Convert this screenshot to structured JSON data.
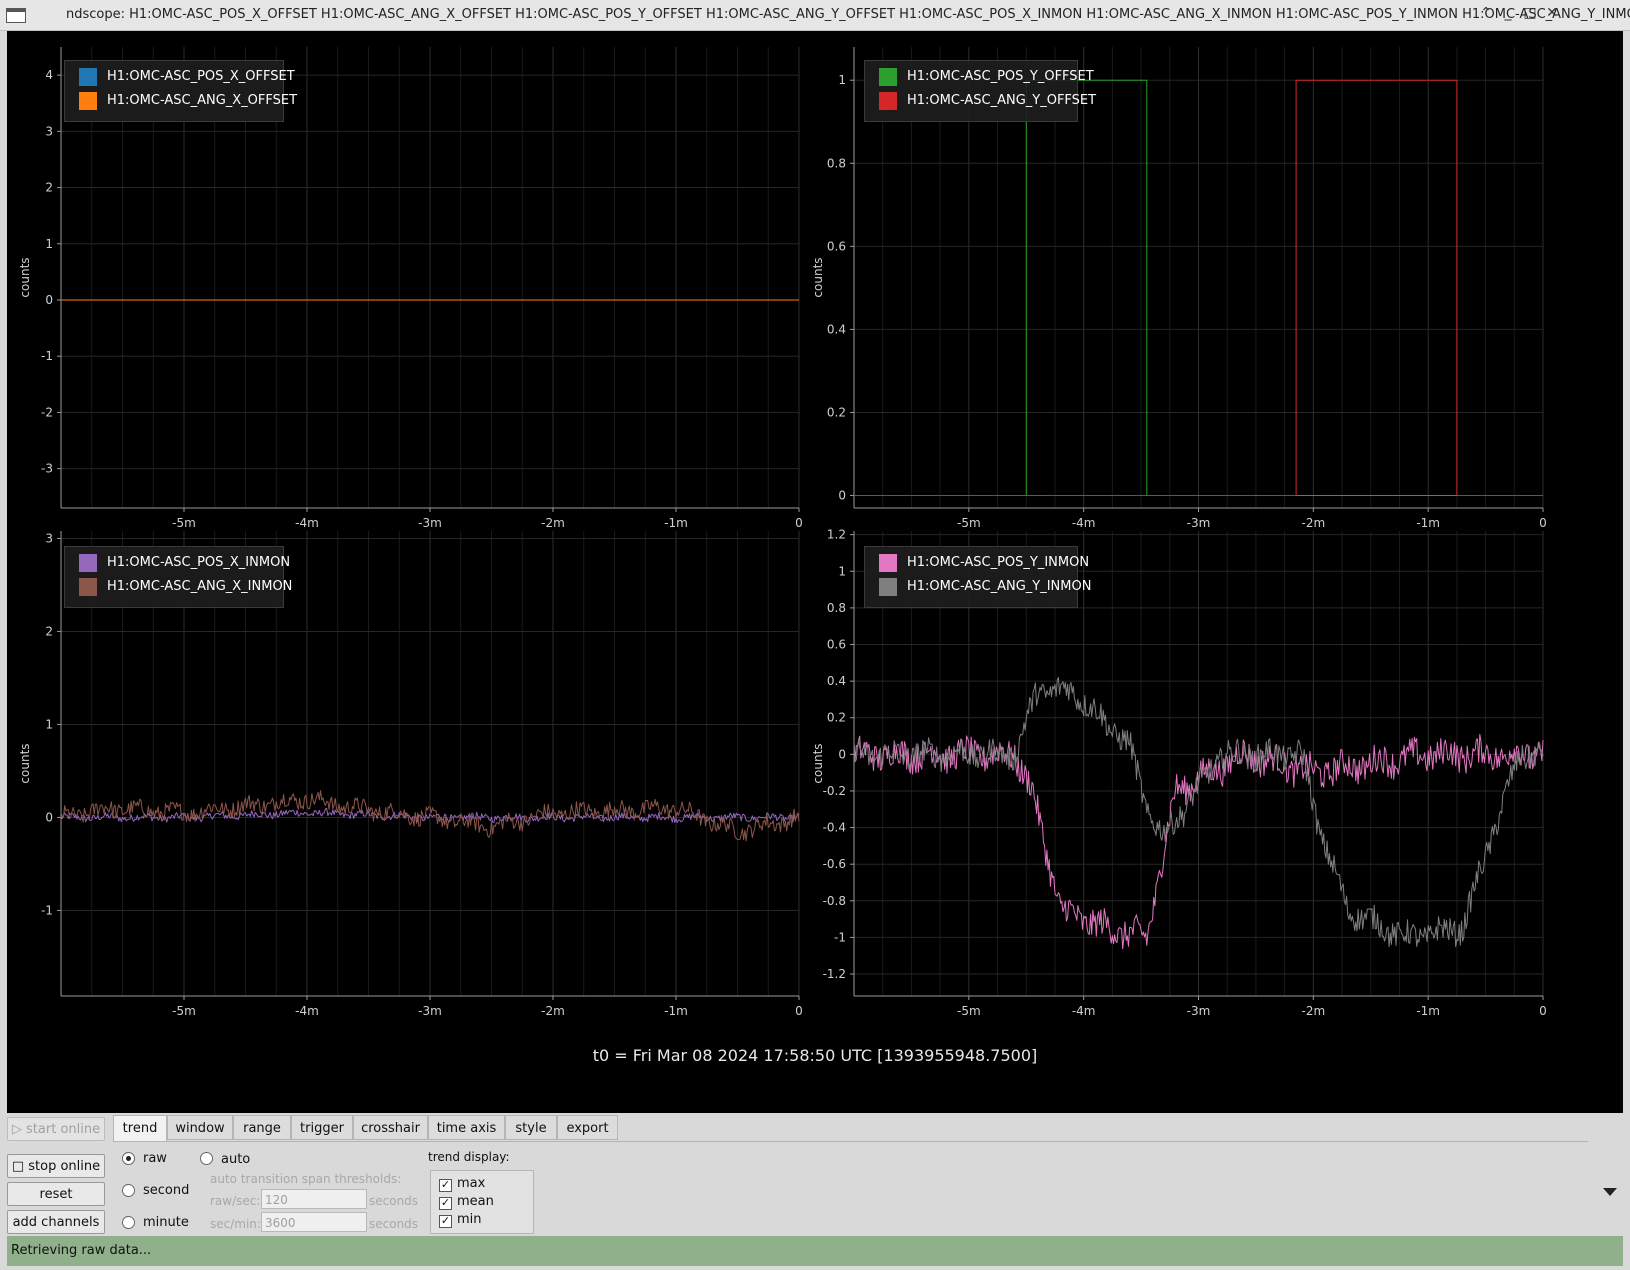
{
  "window": {
    "title": "ndscope: H1:OMC-ASC_POS_X_OFFSET H1:OMC-ASC_ANG_X_OFFSET H1:OMC-ASC_POS_Y_OFFSET H1:OMC-ASC_ANG_Y_OFFSET H1:OMC-ASC_POS_X_INMON H1:OMC-ASC_ANG_X_INMON H1:OMC-ASC_POS_Y_INMON H1:OMC-ASC_ANG_Y_INMON",
    "controls": [
      "⌃",
      "_",
      "□",
      "✕"
    ]
  },
  "plots": [
    {
      "ylabel": "counts",
      "legend": [
        {
          "name": "H1:OMC-ASC_POS_X_OFFSET",
          "color": "#1f77b4"
        },
        {
          "name": "H1:OMC-ASC_ANG_X_OFFSET",
          "color": "#ff7f0e"
        }
      ],
      "yticks": [
        "4",
        "3",
        "2",
        "1",
        "0",
        "-1",
        "-2",
        "-3"
      ],
      "xticks": [
        "-5m",
        "-4m",
        "-3m",
        "-2m",
        "-1m",
        "0"
      ]
    },
    {
      "ylabel": "counts",
      "legend": [
        {
          "name": "H1:OMC-ASC_POS_Y_OFFSET",
          "color": "#2ca02c"
        },
        {
          "name": "H1:OMC-ASC_ANG_Y_OFFSET",
          "color": "#d62728"
        }
      ],
      "yticks": [
        "1",
        "0.8",
        "0.6",
        "0.4",
        "0.2",
        "0"
      ],
      "xticks": [
        "-5m",
        "-4m",
        "-3m",
        "-2m",
        "-1m",
        "0"
      ]
    },
    {
      "ylabel": "counts",
      "legend": [
        {
          "name": "H1:OMC-ASC_POS_X_INMON",
          "color": "#9467bd"
        },
        {
          "name": "H1:OMC-ASC_ANG_X_INMON",
          "color": "#8c564b"
        }
      ],
      "yticks": [
        "3",
        "2",
        "1",
        "0",
        "-1"
      ],
      "xticks": [
        "-5m",
        "-4m",
        "-3m",
        "-2m",
        "-1m",
        "0"
      ]
    },
    {
      "ylabel": "counts",
      "legend": [
        {
          "name": "H1:OMC-ASC_POS_Y_INMON",
          "color": "#e377c2"
        },
        {
          "name": "H1:OMC-ASC_ANG_Y_INMON",
          "color": "#7f7f7f"
        }
      ],
      "yticks": [
        "1.2",
        "1",
        "0.8",
        "0.6",
        "0.4",
        "0.2",
        "0",
        "-0.2",
        "-0.4",
        "-0.6",
        "-0.8",
        "-1",
        "-1.2"
      ],
      "xticks": [
        "-5m",
        "-4m",
        "-3m",
        "-2m",
        "-1m",
        "0"
      ]
    }
  ],
  "t0": "t0 = Fri Mar 08 2024 17:58:50 UTC [1393955948.7500]",
  "sidebar": {
    "start_online": "start online",
    "stop_online": "stop online",
    "reset": "reset",
    "add_channels": "add channels"
  },
  "tabs": [
    "trend",
    "window",
    "range",
    "trigger",
    "crosshair",
    "time axis",
    "style",
    "export"
  ],
  "trend_tab": {
    "raw": "raw",
    "second": "second",
    "minute": "minute",
    "auto": "auto",
    "thresholds_label": "auto transition span thresholds:",
    "raw_sec_label": "raw/sec:",
    "raw_sec_value": "120",
    "sec_min_label": "sec/min:",
    "sec_min_value": "3600",
    "seconds_label": "seconds",
    "trend_display_label": "trend display:",
    "trend_display": [
      "max",
      "mean",
      "min"
    ],
    "selected_mode": "raw"
  },
  "status": "Retrieving raw data...",
  "chart_data": [
    {
      "type": "line",
      "ylim": [
        -3.7,
        4.5
      ],
      "xlim": [
        -6,
        0
      ],
      "series": [
        {
          "name": "H1:OMC-ASC_POS_X_OFFSET",
          "x": [
            -6,
            0
          ],
          "values": [
            0,
            0
          ]
        },
        {
          "name": "H1:OMC-ASC_ANG_X_OFFSET",
          "x": [
            -6,
            0
          ],
          "values": [
            0,
            0
          ]
        }
      ]
    },
    {
      "type": "line",
      "ylim": [
        -0.03,
        1.08
      ],
      "xlim": [
        -6,
        0
      ],
      "series": [
        {
          "name": "H1:OMC-ASC_POS_Y_OFFSET",
          "x": [
            -6,
            -4.5,
            -4.5,
            -3.45,
            -3.45,
            0
          ],
          "values": [
            0,
            0,
            1,
            1,
            0,
            0
          ]
        },
        {
          "name": "H1:OMC-ASC_ANG_Y_OFFSET",
          "x": [
            -6,
            -2.15,
            -2.15,
            -0.75,
            -0.75,
            0
          ],
          "values": [
            0,
            0,
            1,
            1,
            0,
            0
          ]
        }
      ]
    },
    {
      "type": "line",
      "ylim": [
        -1.92,
        3.08
      ],
      "xlim": [
        -6,
        0
      ],
      "series": [
        {
          "name": "H1:OMC-ASC_POS_X_INMON",
          "x": [
            -6,
            -5,
            -4,
            -3,
            -2,
            -1,
            0
          ],
          "values": [
            0,
            0,
            0.05,
            0,
            0,
            0,
            0
          ]
        },
        {
          "name": "H1:OMC-ASC_ANG_X_INMON",
          "x": [
            -6,
            -5.6,
            -5,
            -4,
            -3.6,
            -3,
            -2.5,
            -2,
            -1,
            -0.5,
            0
          ],
          "values": [
            0,
            0.1,
            0.05,
            0.2,
            0.1,
            0,
            -0.1,
            0.05,
            0.1,
            -0.15,
            0
          ]
        }
      ]
    },
    {
      "type": "line",
      "ylim": [
        -1.32,
        1.22
      ],
      "xlim": [
        -6,
        0
      ],
      "series": [
        {
          "name": "H1:OMC-ASC_POS_Y_INMON",
          "x": [
            -6,
            -4.6,
            -4.45,
            -4.2,
            -3.8,
            -3.45,
            -3.2,
            -2.6,
            -2,
            -1,
            0
          ],
          "values": [
            0,
            0,
            -0.2,
            -0.85,
            -0.95,
            -1.0,
            -0.2,
            0,
            -0.1,
            0,
            0
          ]
        },
        {
          "name": "H1:OMC-ASC_ANG_Y_INMON",
          "x": [
            -6,
            -4.6,
            -4.4,
            -4.1,
            -3.6,
            -3.45,
            -3.3,
            -2.8,
            -2.1,
            -1.95,
            -1.7,
            -1.2,
            -0.7,
            -0.45,
            -0.2,
            0
          ],
          "values": [
            0,
            0,
            0.35,
            0.35,
            0.05,
            -0.3,
            -0.45,
            0,
            0,
            -0.4,
            -0.85,
            -1.0,
            -0.95,
            -0.45,
            0,
            0
          ]
        }
      ]
    }
  ]
}
